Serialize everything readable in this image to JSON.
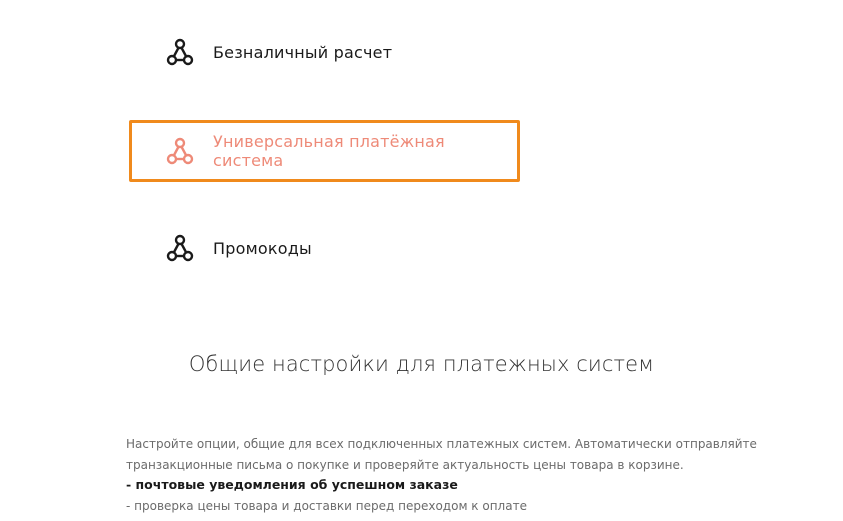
{
  "menu": {
    "items": [
      {
        "icon": "share-icon",
        "label": "Безналичный расчет",
        "active": false
      },
      {
        "icon": "share-icon",
        "label": "Универсальная платёжная система",
        "active": true
      },
      {
        "icon": "share-icon",
        "label": "Промокоды",
        "active": false
      }
    ]
  },
  "section": {
    "title": "Общие настройки для платежных систем",
    "description_line_1": "Настройте опции, общие для всех подключенных платежных систем. Автоматически отправляйте",
    "description_line_2": "транзакционные письма о покупке и проверяйте актуальность цены товара в корзине.",
    "feature_1": "- почтовые уведомления об успешном заказе",
    "feature_2": "- проверка цены товара и доставки перед переходом к оплате"
  },
  "colors": {
    "active_text": "#ee8a78",
    "active_border": "#f08a1c",
    "text": "#1a1a1a",
    "muted_text": "#6b6b6b"
  }
}
